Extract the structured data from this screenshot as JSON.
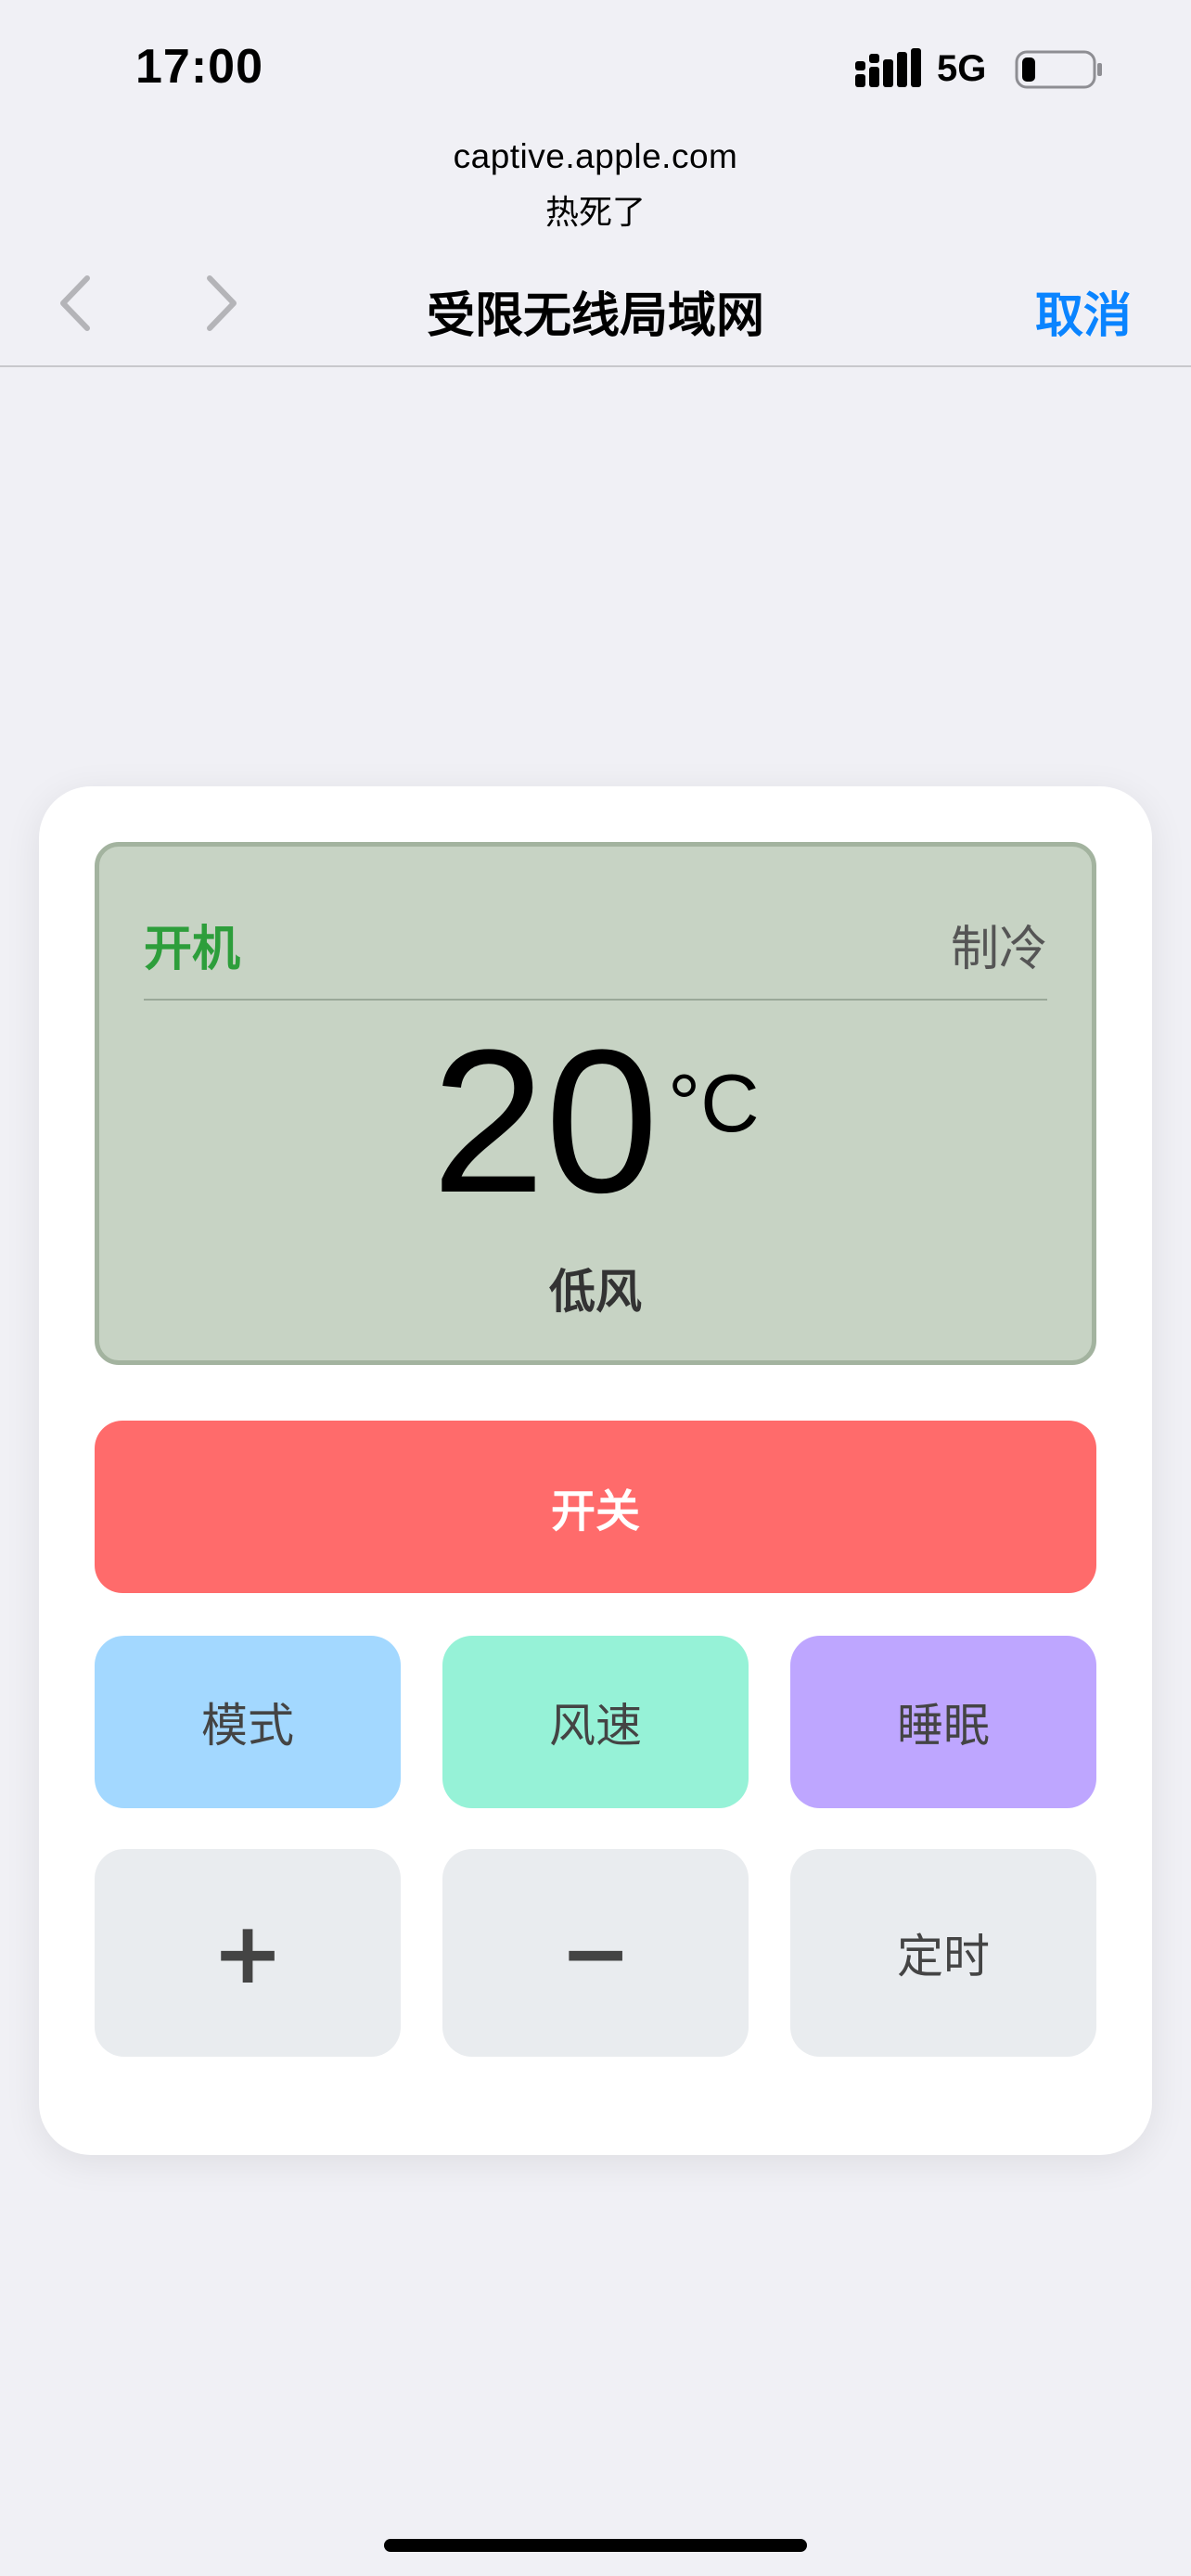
{
  "status_bar": {
    "time": "17:00",
    "network": "5G",
    "battery_level": 0.2
  },
  "captive": {
    "url": "captive.apple.com",
    "subtitle": "热死了"
  },
  "nav": {
    "title": "受限无线局域网",
    "cancel_label": "取消",
    "back_icon": "chevron-left-icon",
    "forward_icon": "chevron-right-icon"
  },
  "display": {
    "power_state": "开机",
    "mode": "制冷",
    "temperature": "20",
    "unit": "°C",
    "fan": "低风"
  },
  "controls": {
    "power_label": "开关",
    "mode_label": "模式",
    "fan_label": "风速",
    "sleep_label": "睡眠",
    "plus_label": "+",
    "minus_label": "−",
    "timer_label": "定时"
  },
  "colors": {
    "power_on_text": "#2d9e3b",
    "power_button": "#ff6b6b",
    "mode_button": "#a3d8ff",
    "fan_button": "#96f2d7",
    "sleep_button": "#bea6ff",
    "display_bg": "#c7d3c4",
    "accent": "#0a84ff"
  }
}
